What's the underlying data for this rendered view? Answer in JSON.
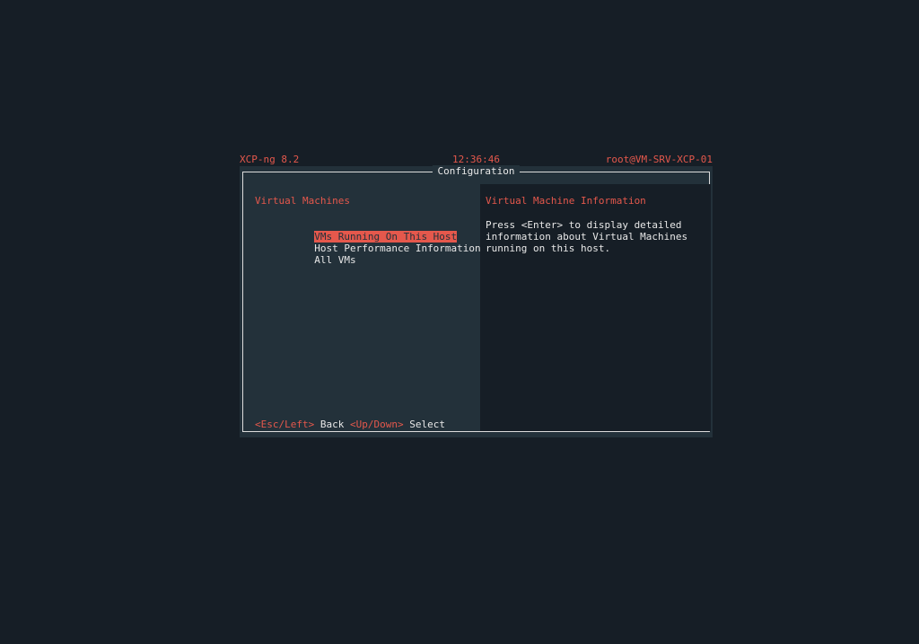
{
  "status_bar": {
    "product": "XCP-ng 8.2",
    "clock": "12:36:46",
    "user_host": "root@VM-SRV-XCP-01"
  },
  "window": {
    "title": "Configuration"
  },
  "left_pane": {
    "heading": "Virtual Machines",
    "menu": [
      {
        "label": "VMs Running On This Host",
        "selected": true
      },
      {
        "label": "Host Performance Information",
        "selected": false
      },
      {
        "label": "All VMs",
        "selected": false
      }
    ]
  },
  "right_pane": {
    "heading": "Virtual Machine Information",
    "text": "Press <Enter> to display detailed\ninformation about Virtual Machines\nrunning on this host."
  },
  "hints": {
    "back_key": "<Esc/Left>",
    "back_label": "Back",
    "select_key": "<Up/Down>",
    "select_label": "Select"
  },
  "colors": {
    "accent": "#e5584c",
    "background": "#161e26",
    "panel": "#23313a",
    "text": "#e8e8e8"
  }
}
